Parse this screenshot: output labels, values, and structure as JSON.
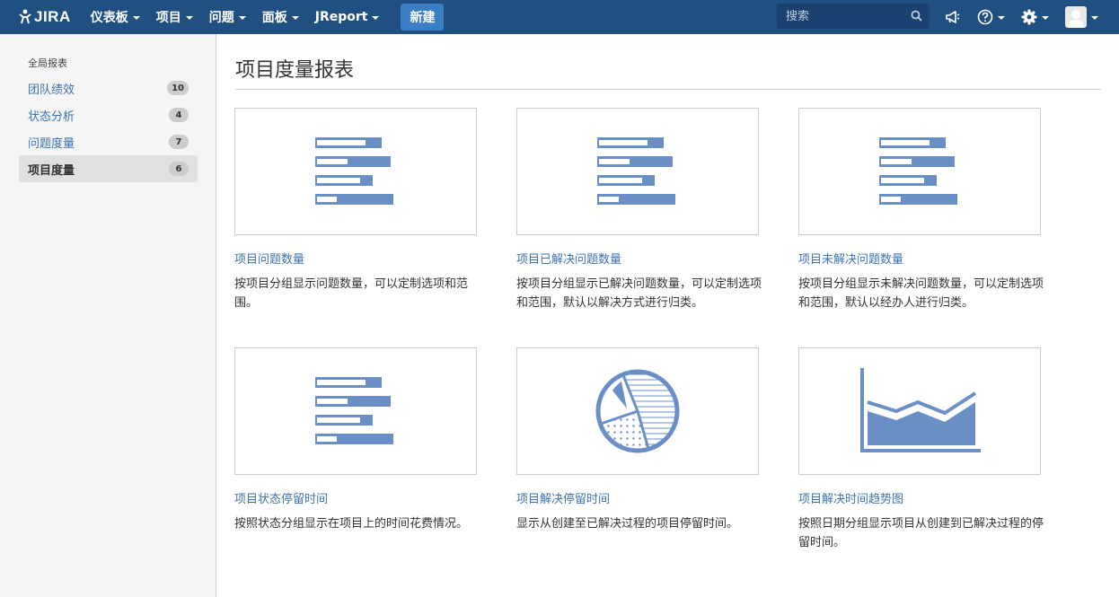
{
  "nav": {
    "logo": "JIRA",
    "items": [
      {
        "label": "仪表板"
      },
      {
        "label": "项目"
      },
      {
        "label": "问题"
      },
      {
        "label": "面板"
      },
      {
        "label": "JReport"
      }
    ],
    "create_label": "新建",
    "search_placeholder": "搜索",
    "icons": [
      "megaphone-icon",
      "help-icon",
      "gear-icon",
      "avatar"
    ]
  },
  "sidebar": {
    "heading": "全局报表",
    "items": [
      {
        "label": "团队绩效",
        "count": "10"
      },
      {
        "label": "状态分析",
        "count": "4"
      },
      {
        "label": "问题度量",
        "count": "7"
      },
      {
        "label": "项目度量",
        "count": "6",
        "active": true
      }
    ]
  },
  "main": {
    "title": "项目度量报表",
    "reports": [
      {
        "title": "项目问题数量",
        "desc": "按项目分组显示问题数量，可以定制选项和范围。",
        "icon": "bar-chart-icon"
      },
      {
        "title": "项目已解决问题数量",
        "desc": "按项目分组显示已解决问题数量，可以定制选项和范围，默认以解决方式进行归类。",
        "icon": "bar-chart-icon"
      },
      {
        "title": "项目未解决问题数量",
        "desc": "按项目分组显示未解决问题数量，可以定制选项和范围，默认以经办人进行归类。",
        "icon": "bar-chart-icon"
      },
      {
        "title": "项目状态停留时间",
        "desc": "按照状态分组显示在项目上的时间花费情况。",
        "icon": "bar-chart-icon"
      },
      {
        "title": "项目解决停留时间",
        "desc": "显示从创建至已解决过程的项目停留时间。",
        "icon": "pie-chart-icon"
      },
      {
        "title": "项目解决时间趋势图",
        "desc": "按照日期分组显示项目从创建到已解决过程的停留时间。",
        "icon": "area-chart-icon"
      }
    ]
  },
  "colors": {
    "nav_bg": "#205081",
    "create_button": "#3b7fc4",
    "link": "#3b73af",
    "icon_blue": "#6a8fc7"
  }
}
